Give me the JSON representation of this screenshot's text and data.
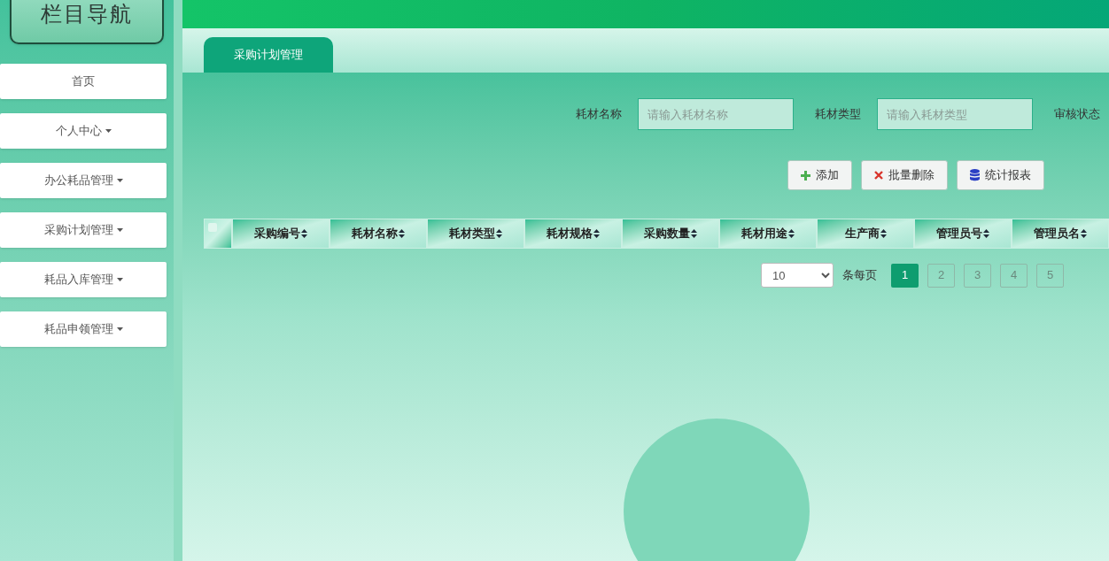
{
  "sidebar": {
    "title": "栏目导航",
    "items": [
      {
        "label": "首页",
        "has_dropdown": false
      },
      {
        "label": "个人中心",
        "has_dropdown": true
      },
      {
        "label": "办公耗品管理",
        "has_dropdown": true
      },
      {
        "label": "采购计划管理",
        "has_dropdown": true
      },
      {
        "label": "耗品入库管理",
        "has_dropdown": true
      },
      {
        "label": "耗品申领管理",
        "has_dropdown": true
      }
    ]
  },
  "tabs": [
    {
      "label": "采购计划管理",
      "selected": true
    }
  ],
  "search": {
    "fields": [
      {
        "label": "耗材名称",
        "placeholder": "请输入耗材名称"
      },
      {
        "label": "耗材类型",
        "placeholder": "请输入耗材类型"
      }
    ],
    "extra_label": "审核状态"
  },
  "actions": [
    {
      "kind": "add",
      "label": "添加"
    },
    {
      "kind": "delete",
      "label": "批量删除"
    },
    {
      "kind": "report",
      "label": "统计报表"
    }
  ],
  "table": {
    "select_all": {
      "checked": false
    },
    "columns": [
      "采购编号",
      "耗材名称",
      "耗材类型",
      "耗材规格",
      "采购数量",
      "耗材用途",
      "生产商",
      "管理员号",
      "管理员名"
    ]
  },
  "pagination": {
    "page_size": "10",
    "page_size_label": "条每页",
    "pages": [
      {
        "label": "1",
        "selected": true
      },
      {
        "label": "2",
        "selected": false
      },
      {
        "label": "3",
        "selected": false
      },
      {
        "label": "4",
        "selected": false
      },
      {
        "label": "5",
        "selected": false
      }
    ]
  }
}
